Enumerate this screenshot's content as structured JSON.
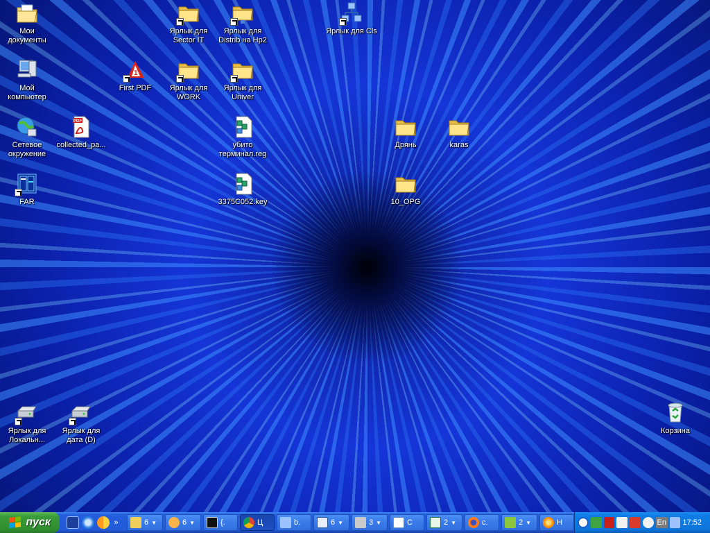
{
  "desktop": {
    "icons": [
      {
        "label": "Мои\nдокументы",
        "icon": "my-documents-icon"
      },
      {
        "label": "Ярлык для\nSector IT",
        "icon": "folder-icon"
      },
      {
        "label": "Ярлык для\nDistrib на Hp2",
        "icon": "network-folder-icon"
      },
      {
        "label": "Ярлык для Cls",
        "icon": "network-icon"
      },
      {
        "label": "Мой\nкомпьютер",
        "icon": "my-computer-icon"
      },
      {
        "label": "First PDF",
        "icon": "pdf-app-icon"
      },
      {
        "label": "Ярлык для\nWORK",
        "icon": "folder-icon"
      },
      {
        "label": "Ярлык для\nUniver",
        "icon": "folder-icon"
      },
      {
        "label": "Сетевое\nокружение",
        "icon": "network-places-icon"
      },
      {
        "label": "collected_pa...",
        "icon": "pdf-file-icon"
      },
      {
        "label": "убито\nтерминал.reg",
        "icon": "registry-file-icon"
      },
      {
        "label": "Дрянь",
        "icon": "folder-icon"
      },
      {
        "label": "karas",
        "icon": "folder-icon"
      },
      {
        "label": "FAR",
        "icon": "far-manager-icon"
      },
      {
        "label": "3375C052.key",
        "icon": "key-file-icon"
      },
      {
        "label": "10_OPG",
        "icon": "folder-icon"
      },
      {
        "label": "Ярлык для\nЛокальн...",
        "icon": "drive-icon"
      },
      {
        "label": "Ярлык для\nдата (D)",
        "icon": "drive-icon"
      },
      {
        "label": "Корзина",
        "icon": "recycle-bin-icon"
      }
    ]
  },
  "taskbar": {
    "start_label": "пуск",
    "quick_launch_more": "»",
    "tasks": [
      {
        "label": "6",
        "icon": "folder-group-icon",
        "has_arrow": true
      },
      {
        "label": "6",
        "icon": "browser-group-icon",
        "has_arrow": true
      },
      {
        "label": "{.",
        "icon": "cmd-icon",
        "has_arrow": false
      },
      {
        "label": "Ц",
        "icon": "chrome-icon",
        "has_arrow": false,
        "active": true
      },
      {
        "label": "b.",
        "icon": "network-app-icon",
        "has_arrow": false
      },
      {
        "label": "6",
        "icon": "word-group-icon",
        "has_arrow": true
      },
      {
        "label": "3",
        "icon": "tool-group-icon",
        "has_arrow": true
      },
      {
        "label": "С",
        "icon": "notepad-icon",
        "has_arrow": false
      },
      {
        "label": "2",
        "icon": "excel-group-icon",
        "has_arrow": true
      },
      {
        "label": "c.",
        "icon": "firefox-icon",
        "has_arrow": false
      },
      {
        "label": "2",
        "icon": "remote-group-icon",
        "has_arrow": true
      },
      {
        "label": "Н",
        "icon": "app-orange-icon",
        "has_arrow": false
      }
    ],
    "tray": {
      "language": "En",
      "clock": "17:52"
    }
  },
  "colors": {
    "taskbar_blue": "#245edc",
    "start_green": "#3a9b3a",
    "tray_blue": "#0f7de6"
  }
}
